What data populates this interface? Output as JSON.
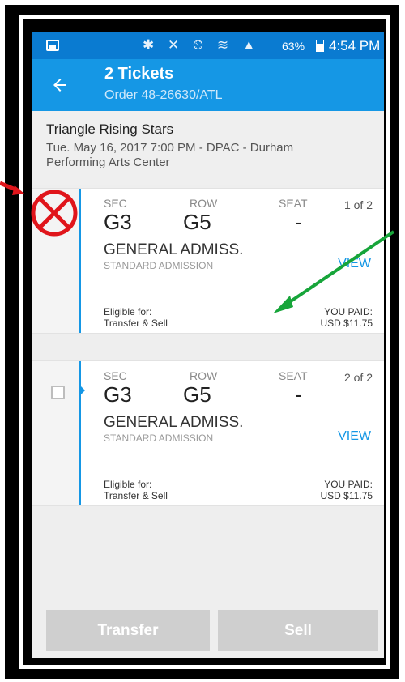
{
  "status_bar": {
    "icons": "✱ ✕ ⏲ ≋ ▲",
    "battery_pct": "63%",
    "time": "4:54 PM"
  },
  "header": {
    "title": "2 Tickets",
    "order": "Order 48-26630/ATL"
  },
  "event": {
    "name": "Triangle Rising Stars",
    "details": "Tue. May 16, 2017 7:00 PM - DPAC - Durham Performing Arts Center"
  },
  "tickets": [
    {
      "sec_label": "SEC",
      "row_label": "ROW",
      "seat_label": "SEAT",
      "count": "1 of 2",
      "sec": "G3",
      "row": "G5",
      "seat": "-",
      "admission": "GENERAL ADMISS.",
      "admission_sub": "STANDARD ADMISSION",
      "view": "VIEW",
      "eligible_line1": "Eligible for:",
      "eligible_line2": "Transfer & Sell",
      "paid_line1": "YOU PAID:",
      "paid_line2": "USD $11.75"
    },
    {
      "sec_label": "SEC",
      "row_label": "ROW",
      "seat_label": "SEAT",
      "count": "2 of 2",
      "sec": "G3",
      "row": "G5",
      "seat": "-",
      "admission": "GENERAL ADMISS.",
      "admission_sub": "STANDARD ADMISSION",
      "view": "VIEW",
      "eligible_line1": "Eligible for:",
      "eligible_line2": "Transfer & Sell",
      "paid_line1": "YOU PAID:",
      "paid_line2": "USD $11.75"
    }
  ],
  "buttons": {
    "transfer": "Transfer",
    "sell": "Sell"
  },
  "colors": {
    "status_bar": "#0a7bd1",
    "app_bar": "#1597e5",
    "accent": "#1597e5",
    "annotation_red": "#e0151b",
    "annotation_green": "#17a53a"
  }
}
